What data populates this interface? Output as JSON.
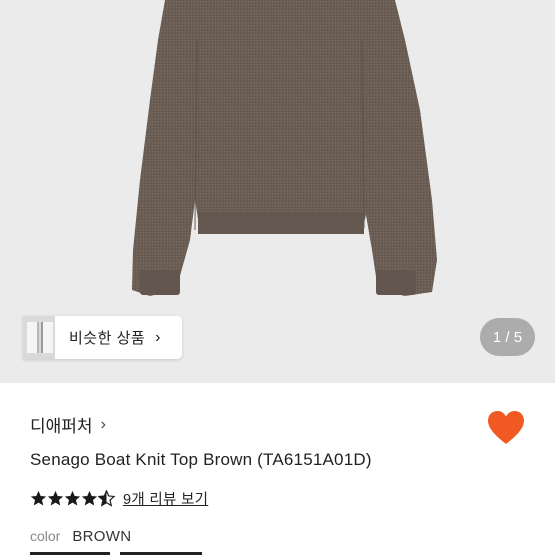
{
  "gallery": {
    "similar_products_label": "비슷한 상품",
    "page_counter": "1 / 5"
  },
  "product": {
    "shop_name": "디애퍼처",
    "title": "Senago Boat Knit Top Brown (TA6151A01D)",
    "rating": 4.5,
    "review_link": "9개 리뷰 보기",
    "color_label": "color",
    "color_value": "BROWN",
    "favorited": true
  },
  "colors": {
    "gallery_bg": "#ebebeb",
    "sweater": "#6b5e55",
    "heart": "#f05a22",
    "star": "#1a1a1a"
  },
  "icons": [
    "chevron-right-icon",
    "heart-icon",
    "star-icon",
    "half-star-icon"
  ]
}
